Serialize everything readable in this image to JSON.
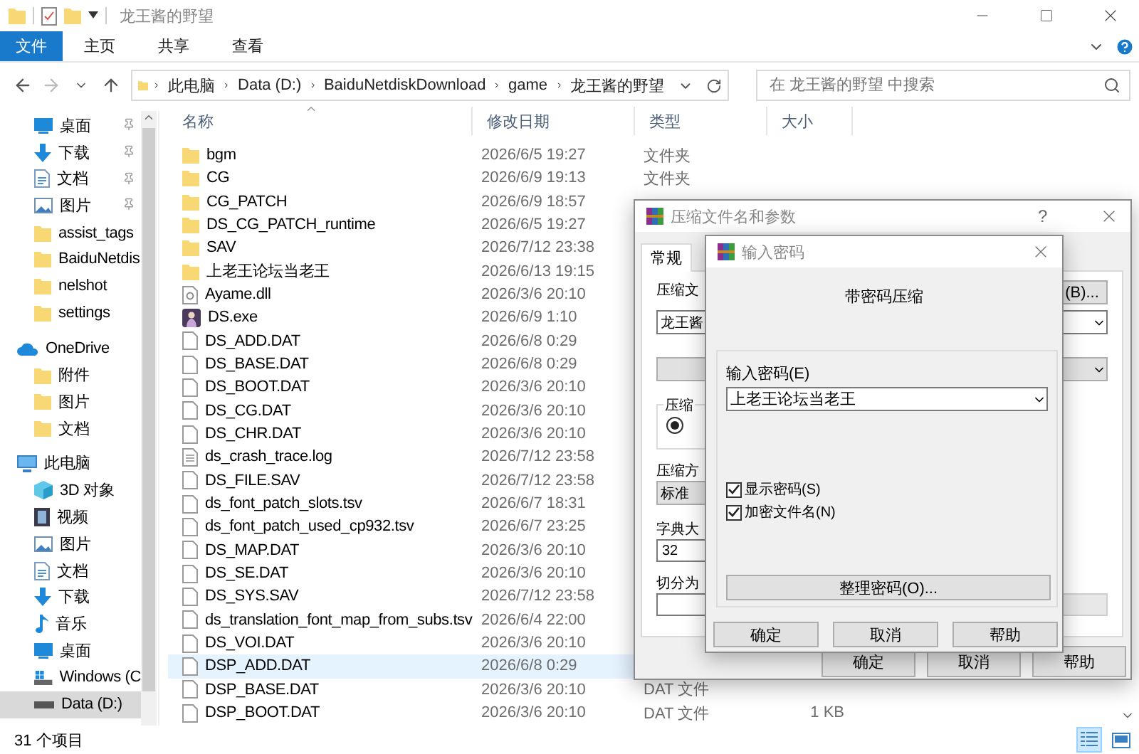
{
  "window": {
    "title": "龙王酱的野望"
  },
  "ribbon": {
    "tabs": [
      {
        "label": "文件",
        "kind": "file"
      },
      {
        "label": "主页",
        "kind": "tab"
      },
      {
        "label": "共享",
        "kind": "tab"
      },
      {
        "label": "查看",
        "kind": "tab"
      }
    ]
  },
  "address": {
    "crumbs": [
      "此电脑",
      "Data (D:)",
      "BaiduNetdiskDownload",
      "game",
      "龙王酱的野望"
    ],
    "search_placeholder": "在 龙王酱的野望 中搜索"
  },
  "sidebar": {
    "groups": [
      {
        "items": [
          {
            "label": "桌面",
            "kind": "desktop",
            "pinned": true,
            "selected": false
          },
          {
            "label": "下载",
            "kind": "download",
            "pinned": true,
            "selected": false
          },
          {
            "label": "文档",
            "kind": "document",
            "pinned": true,
            "selected": false
          },
          {
            "label": "图片",
            "kind": "picture",
            "pinned": true,
            "selected": false
          },
          {
            "label": "assist_tags",
            "kind": "folder",
            "pinned": false,
            "selected": false
          },
          {
            "label": "BaiduNetdis",
            "kind": "folder",
            "pinned": false,
            "selected": false
          },
          {
            "label": "nelshot",
            "kind": "folder",
            "pinned": false,
            "selected": false
          },
          {
            "label": "settings",
            "kind": "folder",
            "pinned": false,
            "selected": false
          }
        ]
      },
      {
        "label": "OneDrive",
        "kind": "cloud",
        "children": [
          {
            "label": "附件",
            "kind": "folder",
            "selected": false
          },
          {
            "label": "图片",
            "kind": "folder",
            "selected": false
          },
          {
            "label": "文档",
            "kind": "folder",
            "selected": false
          }
        ]
      },
      {
        "label": "此电脑",
        "kind": "pc",
        "children": [
          {
            "label": "3D 对象",
            "kind": "cube",
            "selected": false
          },
          {
            "label": "视频",
            "kind": "video",
            "selected": false
          },
          {
            "label": "图片",
            "kind": "picture",
            "selected": false
          },
          {
            "label": "文档",
            "kind": "document",
            "selected": false
          },
          {
            "label": "下载",
            "kind": "download",
            "selected": false
          },
          {
            "label": "音乐",
            "kind": "music",
            "selected": false
          },
          {
            "label": "桌面",
            "kind": "desktop",
            "selected": false
          },
          {
            "label": "Windows (C",
            "kind": "windows_drive",
            "selected": false
          },
          {
            "label": "Data (D:)",
            "kind": "drive",
            "selected": true
          }
        ]
      }
    ]
  },
  "file_list": {
    "columns": [
      {
        "label": "名称",
        "sorted": true
      },
      {
        "label": "修改日期",
        "sorted": false
      },
      {
        "label": "类型",
        "sorted": false
      },
      {
        "label": "大小",
        "sorted": false
      }
    ],
    "rows": [
      {
        "name": "bgm",
        "date": "2026/6/5 19:27",
        "type": "文件夹",
        "kind": "folder",
        "selected": false
      },
      {
        "name": "CG",
        "date": "2026/6/9 19:13",
        "type": "文件夹",
        "kind": "folder",
        "selected": false
      },
      {
        "name": "CG_PATCH",
        "date": "2026/6/9 18:57",
        "kind": "folder",
        "selected": false
      },
      {
        "name": "DS_CG_PATCH_runtime",
        "date": "2026/6/5 19:27",
        "kind": "folder",
        "selected": false
      },
      {
        "name": "SAV",
        "date": "2026/7/12 23:38",
        "kind": "folder",
        "selected": false
      },
      {
        "name": "上老王论坛当老王",
        "date": "2026/6/13 19:15",
        "kind": "folder",
        "selected": false
      },
      {
        "name": "Ayame.dll",
        "date": "2026/3/6 20:10",
        "kind": "dll",
        "selected": false
      },
      {
        "name": "DS.exe",
        "date": "2026/6/9 1:10",
        "kind": "exe",
        "selected": false
      },
      {
        "name": "DS_ADD.DAT",
        "date": "2026/6/8 0:29",
        "kind": "file",
        "selected": false
      },
      {
        "name": "DS_BASE.DAT",
        "date": "2026/6/8 0:29",
        "kind": "file",
        "selected": false
      },
      {
        "name": "DS_BOOT.DAT",
        "date": "2026/3/6 20:10",
        "kind": "file",
        "selected": false
      },
      {
        "name": "DS_CG.DAT",
        "date": "2026/3/6 20:10",
        "kind": "file",
        "selected": false
      },
      {
        "name": "DS_CHR.DAT",
        "date": "2026/3/6 20:10",
        "kind": "file",
        "selected": false
      },
      {
        "name": "ds_crash_trace.log",
        "date": "2026/7/12 23:58",
        "kind": "log",
        "selected": false
      },
      {
        "name": "DS_FILE.SAV",
        "date": "2026/7/12 23:58",
        "kind": "file",
        "selected": false
      },
      {
        "name": "ds_font_patch_slots.tsv",
        "date": "2026/6/7 18:31",
        "kind": "file",
        "selected": false
      },
      {
        "name": "ds_font_patch_used_cp932.tsv",
        "date": "2026/6/7 23:25",
        "kind": "file",
        "selected": false
      },
      {
        "name": "DS_MAP.DAT",
        "date": "2026/3/6 20:10",
        "kind": "file",
        "selected": false
      },
      {
        "name": "DS_SE.DAT",
        "date": "2026/3/6 20:10",
        "kind": "file",
        "selected": false
      },
      {
        "name": "DS_SYS.SAV",
        "date": "2026/7/12 23:58",
        "kind": "file",
        "selected": false
      },
      {
        "name": "ds_translation_font_map_from_subs.tsv",
        "date": "2026/6/4 22:00",
        "kind": "file",
        "selected": false
      },
      {
        "name": "DS_VOI.DAT",
        "date": "2026/3/6 20:10",
        "kind": "file",
        "selected": false
      },
      {
        "name": "DSP_ADD.DAT",
        "date": "2026/6/8 0:29",
        "kind": "file",
        "selected": true
      },
      {
        "name": "DSP_BASE.DAT",
        "date": "2026/3/6 20:10",
        "type": "DAT 文件",
        "kind": "file",
        "selected": false
      },
      {
        "name": "DSP_BOOT.DAT",
        "date": "2026/3/6 20:10",
        "type": "DAT 文件",
        "size": "1 KB",
        "kind": "file",
        "selected": false
      }
    ]
  },
  "status_bar": {
    "item_count": "31 个项目",
    "views": [
      {
        "kind": "details",
        "selected": true
      },
      {
        "kind": "tiles",
        "selected": false
      }
    ]
  },
  "archive_dialog": {
    "title": "压缩文件名和参数",
    "help": "?",
    "tab": "常规",
    "name_label": "压缩文",
    "browse_button": "(B)...",
    "name_value": "龙王酱",
    "group_label": "压缩",
    "radio_selected": true,
    "method_label": "压缩方",
    "method_value": "标准",
    "dict_label": "字典大",
    "dict_value": "32",
    "split_label": "切分为",
    "buttons": [
      "确定",
      "取消",
      "帮助"
    ]
  },
  "password_dialog": {
    "title": "输入密码",
    "heading": "带密码压缩",
    "password_label": "输入密码(E)",
    "password_value": "上老王论坛当老王",
    "options": [
      {
        "label": "显示密码(S)",
        "checked": true
      },
      {
        "label": "加密文件名(N)",
        "checked": true
      }
    ],
    "manage_button": "整理密码(O)...",
    "buttons": [
      "确定",
      "取消",
      "帮助"
    ]
  }
}
